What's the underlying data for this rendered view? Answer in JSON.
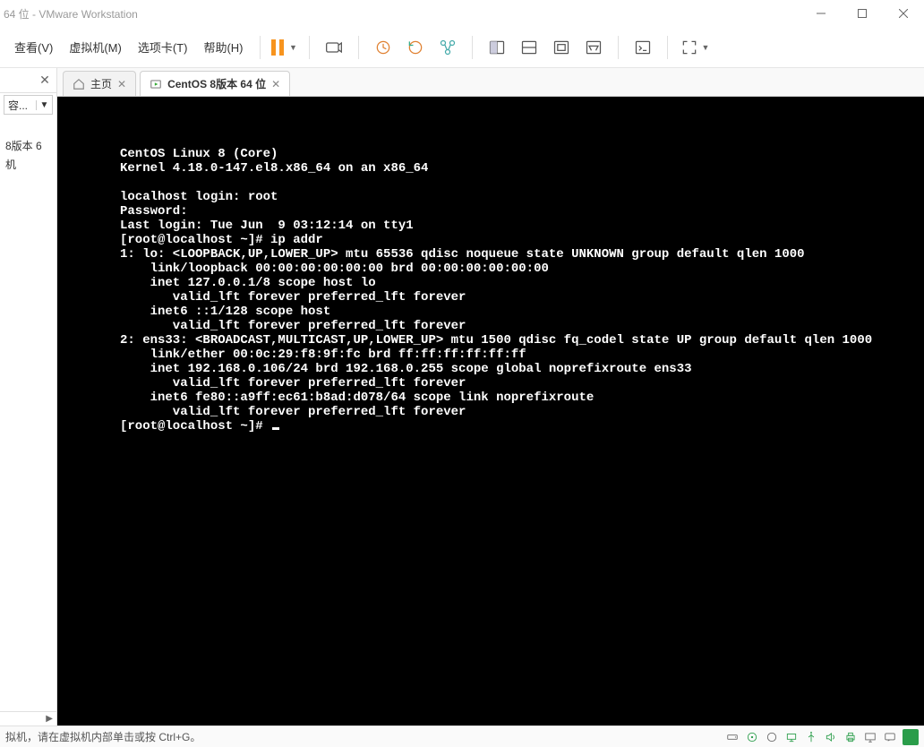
{
  "titlebar": {
    "text": "64 位 - VMware Workstation"
  },
  "menu": {
    "view": "查看(V)",
    "vm": "虚拟机(M)",
    "tabs": "选项卡(T)",
    "help": "帮助(H)"
  },
  "sidebar": {
    "combo": "容...",
    "items": [
      "8版本 6",
      "机"
    ]
  },
  "tabs": {
    "home": {
      "label": "主页"
    },
    "vm": {
      "label": "CentOS 8版本 64 位"
    }
  },
  "terminal": {
    "lines": [
      "CentOS Linux 8 (Core)",
      "Kernel 4.18.0-147.el8.x86_64 on an x86_64",
      "",
      "localhost login: root",
      "Password:",
      "Last login: Tue Jun  9 03:12:14 on tty1",
      "[root@localhost ~]# ip addr",
      "1: lo: <LOOPBACK,UP,LOWER_UP> mtu 65536 qdisc noqueue state UNKNOWN group default qlen 1000",
      "    link/loopback 00:00:00:00:00:00 brd 00:00:00:00:00:00",
      "    inet 127.0.0.1/8 scope host lo",
      "       valid_lft forever preferred_lft forever",
      "    inet6 ::1/128 scope host",
      "       valid_lft forever preferred_lft forever",
      "2: ens33: <BROADCAST,MULTICAST,UP,LOWER_UP> mtu 1500 qdisc fq_codel state UP group default qlen 1000",
      "    link/ether 00:0c:29:f8:9f:fc brd ff:ff:ff:ff:ff:ff",
      "    inet 192.168.0.106/24 brd 192.168.0.255 scope global noprefixroute ens33",
      "       valid_lft forever preferred_lft forever",
      "    inet6 fe80::a9ff:ec61:b8ad:d078/64 scope link noprefixroute",
      "       valid_lft forever preferred_lft forever",
      "[root@localhost ~]# "
    ]
  },
  "statusbar": {
    "hint": "拟机，请在虚拟机内部单击或按 Ctrl+G。"
  }
}
